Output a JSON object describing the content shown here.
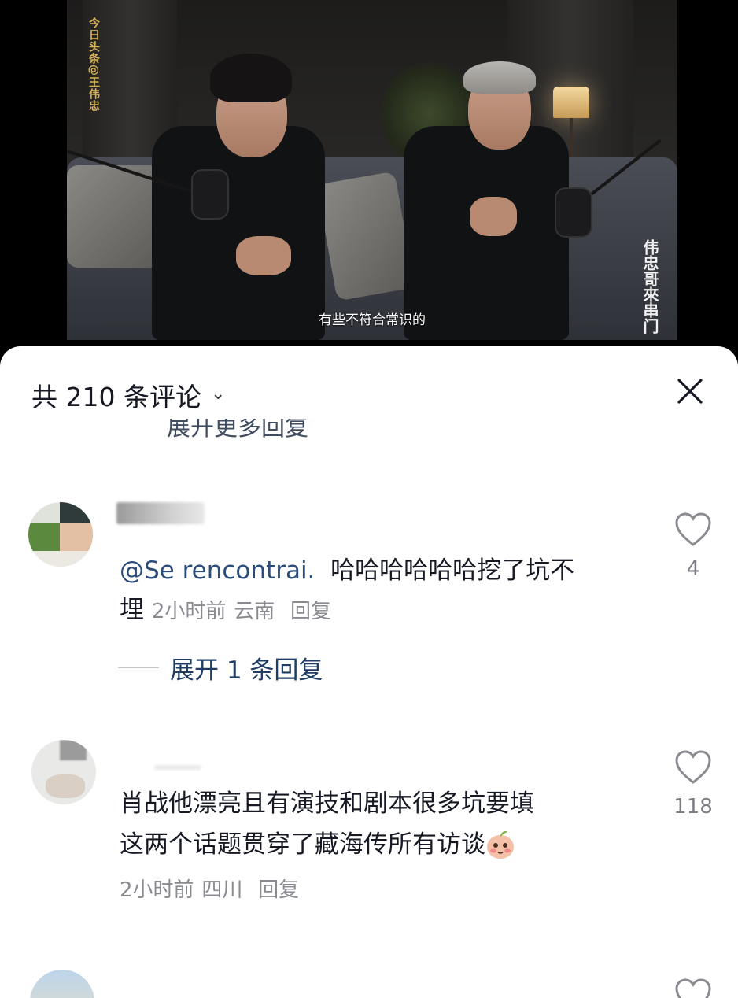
{
  "video": {
    "watermark_left": "今日头条@王伟忠",
    "watermark_right": "伟忠哥來串门",
    "subtitle": "有些不符合常识的"
  },
  "comments_header": {
    "title": "共 210 条评论",
    "close_icon": "close-icon"
  },
  "previous_expand_partial": "展开更多回复",
  "comments": [
    {
      "mention": "@Se rencontrai.",
      "body_line1": "哈哈哈哈哈哈挖了坑不",
      "body_line2": "埋",
      "time": "2小时前",
      "location": "云南",
      "reply_label": "回复",
      "likes": "4",
      "expand_label": "展开 1 条回复"
    },
    {
      "body_line1": "肖战他漂亮且有演技和剧本很多坑要填",
      "body_line2": "这两个话题贯穿了藏海传所有访谈",
      "emoji": "blush-peach-emoji",
      "time": "2小时前",
      "location": "四川",
      "reply_label": "回复",
      "likes": "118"
    }
  ],
  "colors": {
    "panel_bg": "#ffffff",
    "text_primary": "#161823",
    "text_meta": "#8a8b91",
    "mention": "#2b4d7b",
    "expand_link": "#1f3d63"
  }
}
